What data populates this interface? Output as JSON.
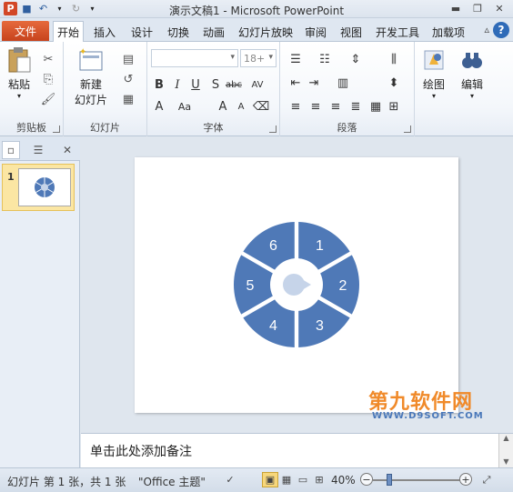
{
  "window": {
    "title": "演示文稿1 - Microsoft PowerPoint",
    "app_icon": "P"
  },
  "tabs": {
    "file": "文件",
    "items": [
      "开始",
      "插入",
      "设计",
      "切换",
      "动画",
      "幻灯片放映",
      "审阅",
      "视图",
      "开发工具",
      "加载项"
    ],
    "active": "开始"
  },
  "ribbon": {
    "clipboard": {
      "label": "剪贴板",
      "paste": "粘贴"
    },
    "slides": {
      "label": "幻灯片",
      "new_slide_line1": "新建",
      "new_slide_line2": "幻灯片"
    },
    "font": {
      "label": "字体",
      "font_size": "18+"
    },
    "paragraph": {
      "label": "段落"
    },
    "drawing": {
      "label": "绘图"
    },
    "editing": {
      "label": "编辑"
    }
  },
  "slide_thumbnail": {
    "number": "1"
  },
  "diagram": {
    "segments": [
      "1",
      "2",
      "3",
      "4",
      "5",
      "6"
    ],
    "segment_color": "#4f79b7",
    "center_color": "#c6d4e9"
  },
  "watermark": {
    "main": "第九软件网",
    "sub": "WWW.D9SOFT.COM"
  },
  "notes": {
    "placeholder": "单击此处添加备注"
  },
  "status": {
    "slide_info": "幻灯片 第 1 张，共 1 张",
    "theme": "\"Office 主题\"",
    "zoom": "40%"
  }
}
